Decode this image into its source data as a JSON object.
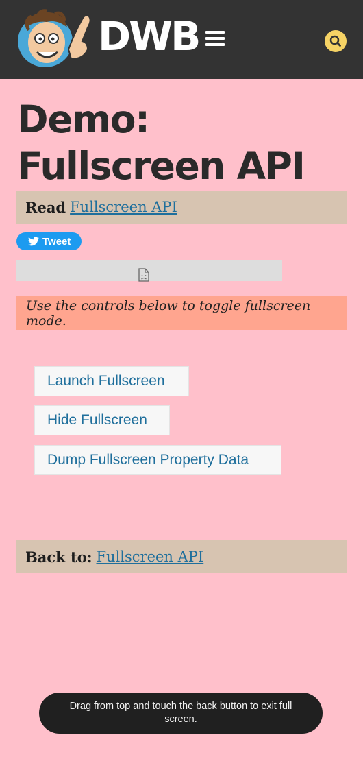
{
  "header": {
    "brand": "DWB",
    "avatar_icon": "cartoon-face-logo",
    "menu_icon": "hamburger-icon",
    "search_icon": "magnifier-icon",
    "colors": {
      "background": "#333333",
      "search_button": "#f6d365"
    }
  },
  "page": {
    "title": "Demo: Fullscreen API",
    "read_label": "Read",
    "read_link": "Fullscreen API",
    "tweet_label": "Tweet",
    "instructions": "Use the controls below to toggle fullscreen mode.",
    "buttons": {
      "launch": "Launch Fullscreen",
      "hide": "Hide Fullscreen",
      "dump": "Dump Fullscreen Property Data"
    },
    "back_label": "Back to:",
    "back_link": "Fullscreen API"
  },
  "toast": {
    "message": "Drag from top and touch the back button to exit full screen."
  },
  "colors": {
    "page_background": "#ffc0cb",
    "note_background": "#d7c4b1",
    "instructions_background": "#ffa58f",
    "link": "#1f6f9c",
    "tweet": "#1d9bf0"
  }
}
